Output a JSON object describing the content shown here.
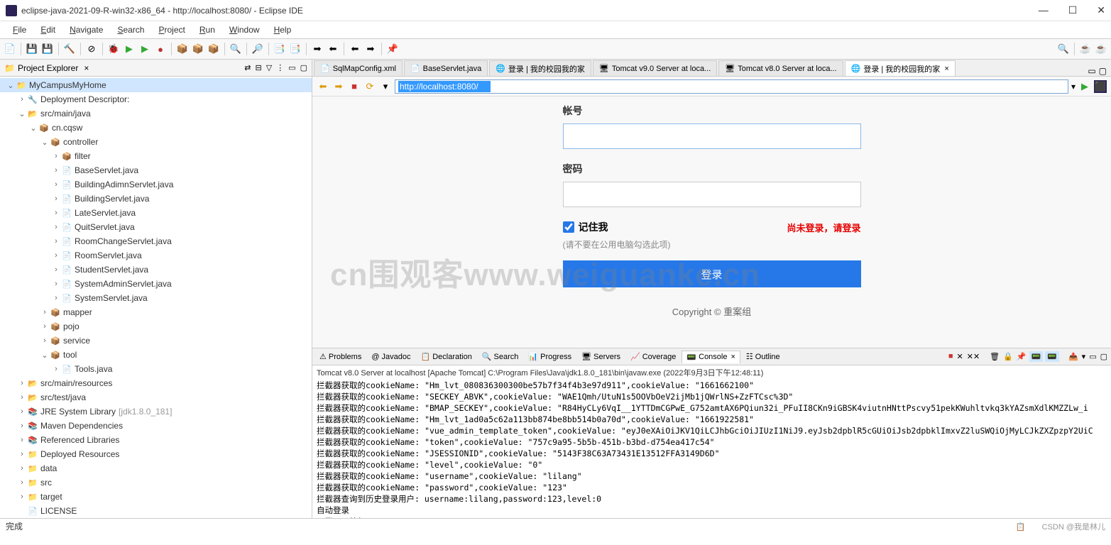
{
  "window": {
    "title": "eclipse-java-2021-09-R-win32-x86_64 - http://localhost:8080/ - Eclipse IDE"
  },
  "menu": [
    "File",
    "Edit",
    "Navigate",
    "Search",
    "Project",
    "Run",
    "Window",
    "Help"
  ],
  "projectExplorer": {
    "title": "Project Explorer",
    "tree": [
      {
        "depth": 0,
        "exp": "v",
        "icon": "📁",
        "label": "MyCampusMyHome",
        "selected": true
      },
      {
        "depth": 1,
        "exp": ">",
        "icon": "🔧",
        "label": "Deployment Descriptor: <web app>"
      },
      {
        "depth": 1,
        "exp": "v",
        "icon": "📂",
        "label": "src/main/java"
      },
      {
        "depth": 2,
        "exp": "v",
        "icon": "📦",
        "label": "cn.cqsw"
      },
      {
        "depth": 3,
        "exp": "v",
        "icon": "📦",
        "label": "controller"
      },
      {
        "depth": 4,
        "exp": ">",
        "icon": "📦",
        "label": "filter"
      },
      {
        "depth": 4,
        "exp": ">",
        "icon": "📄",
        "label": "BaseServlet.java"
      },
      {
        "depth": 4,
        "exp": ">",
        "icon": "📄",
        "label": "BuildingAdimnServlet.java"
      },
      {
        "depth": 4,
        "exp": ">",
        "icon": "📄",
        "label": "BuildingServlet.java"
      },
      {
        "depth": 4,
        "exp": ">",
        "icon": "📄",
        "label": "LateServlet.java"
      },
      {
        "depth": 4,
        "exp": ">",
        "icon": "📄",
        "label": "QuitServlet.java"
      },
      {
        "depth": 4,
        "exp": ">",
        "icon": "📄",
        "label": "RoomChangeServlet.java"
      },
      {
        "depth": 4,
        "exp": ">",
        "icon": "📄",
        "label": "RoomServlet.java"
      },
      {
        "depth": 4,
        "exp": ">",
        "icon": "📄",
        "label": "StudentServlet.java"
      },
      {
        "depth": 4,
        "exp": ">",
        "icon": "📄",
        "label": "SystemAdminServlet.java"
      },
      {
        "depth": 4,
        "exp": ">",
        "icon": "📄",
        "label": "SystemServlet.java"
      },
      {
        "depth": 3,
        "exp": ">",
        "icon": "📦",
        "label": "mapper"
      },
      {
        "depth": 3,
        "exp": ">",
        "icon": "📦",
        "label": "pojo"
      },
      {
        "depth": 3,
        "exp": ">",
        "icon": "📦",
        "label": "service"
      },
      {
        "depth": 3,
        "exp": "v",
        "icon": "📦",
        "label": "tool"
      },
      {
        "depth": 4,
        "exp": ">",
        "icon": "📄",
        "label": "Tools.java"
      },
      {
        "depth": 1,
        "exp": ">",
        "icon": "📂",
        "label": "src/main/resources"
      },
      {
        "depth": 1,
        "exp": ">",
        "icon": "📂",
        "label": "src/test/java"
      },
      {
        "depth": 1,
        "exp": ">",
        "icon": "📚",
        "label": "JRE System Library",
        "suffix": "[jdk1.8.0_181]"
      },
      {
        "depth": 1,
        "exp": ">",
        "icon": "📚",
        "label": "Maven Dependencies"
      },
      {
        "depth": 1,
        "exp": ">",
        "icon": "📚",
        "label": "Referenced Libraries"
      },
      {
        "depth": 1,
        "exp": ">",
        "icon": "📁",
        "label": "Deployed Resources"
      },
      {
        "depth": 1,
        "exp": ">",
        "icon": "📁",
        "label": "data"
      },
      {
        "depth": 1,
        "exp": ">",
        "icon": "📁",
        "label": "src"
      },
      {
        "depth": 1,
        "exp": ">",
        "icon": "📁",
        "label": "target"
      },
      {
        "depth": 1,
        "exp": "",
        "icon": "📄",
        "label": "LICENSE"
      }
    ]
  },
  "editorTabs": [
    {
      "icon": "📄",
      "label": "SqlMapConfig.xml"
    },
    {
      "icon": "📄",
      "label": "BaseServlet.java"
    },
    {
      "icon": "🌐",
      "label": "登录 | 我的校园我的家"
    },
    {
      "icon": "🖥",
      "label": "Tomcat v9.0 Server at loca..."
    },
    {
      "icon": "🖥",
      "label": "Tomcat v8.0 Server at loca..."
    },
    {
      "icon": "🌐",
      "label": "登录 | 我的校园我的家",
      "active": true
    }
  ],
  "browser": {
    "url": "http://localhost:8080/"
  },
  "loginForm": {
    "userLabel": "帐号",
    "passLabel": "密码",
    "rememberLabel": "记住我",
    "warnText": "尚未登录，请登录",
    "hint": "(请不要在公用电脑勾选此项)",
    "loginBtn": "登录",
    "copyright": "Copyright © 重案组"
  },
  "watermark": "cn围观客www.weiguanke.cn",
  "bottomTabs": [
    {
      "icon": "⚠",
      "label": "Problems"
    },
    {
      "icon": "@",
      "label": "Javadoc"
    },
    {
      "icon": "📋",
      "label": "Declaration"
    },
    {
      "icon": "🔍",
      "label": "Search"
    },
    {
      "icon": "📊",
      "label": "Progress"
    },
    {
      "icon": "🖥",
      "label": "Servers"
    },
    {
      "icon": "📈",
      "label": "Coverage"
    },
    {
      "icon": "📟",
      "label": "Console",
      "active": true
    },
    {
      "icon": "☷",
      "label": "Outline"
    }
  ],
  "console": {
    "header": "Tomcat v8.0 Server at localhost [Apache Tomcat] C:\\Program Files\\Java\\jdk1.8.0_181\\bin\\javaw.exe  (2022年9月3日下午12:48:11)",
    "lines": [
      "拦截器获取的cookieName: \"Hm_lvt_080836300300be57b7f34f4b3e97d911\",cookieValue: \"1661662100\"",
      "拦截器获取的cookieName: \"SECKEY_ABVK\",cookieValue: \"WAE1Qmh/UtuN1s5OOVbOeV2ijMb1jQWrlNS+ZzFTCsc%3D\"",
      "拦截器获取的cookieName: \"BMAP_SECKEY\",cookieValue: \"R84HyCLy6VqI__1YTTDmCGPwE_G752amtAX6PQiun32i_PFuII8CKn9iGBSK4viutnHNttPscvy51pekKWuhltvkq3kYAZsmXdlKMZZLw_i",
      "拦截器获取的cookieName: \"Hm_lvt_1ad0a5c62a113bb874be8bb514b0a70d\",cookieValue: \"1661922581\"",
      "拦截器获取的cookieName: \"vue_admin_template_token\",cookieValue: \"eyJ0eXAiOiJKV1QiLCJhbGciOiJIUzI1NiJ9.eyJsb2dpblR5cGUiOiJsb2dpbklImxvZ2luSWQiOjMyLCJkZXZpzpY2UiC",
      "拦截器获取的cookieName: \"token\",cookieValue: \"757c9a95-5b5b-451b-b3bd-d754ea417c54\"",
      "拦截器获取的cookieName: \"JSESSIONID\",cookieValue: \"5143F38C63A73431E13512FFA3149D6D\"",
      "拦截器获取的cookieName: \"level\",cookieValue: \"0\"",
      "拦截器获取的cookieName: \"username\",cookieValue: \"lilang\"",
      "拦截器获取的cookieName: \"password\",cookieValue: \"123\"",
      "拦截器查询到历史登录用户: username:lilang,password:123,level:0",
      "自动登录",
      "已登录，放行"
    ]
  },
  "status": {
    "left": "完成",
    "right": "CSDN @我是林儿"
  }
}
